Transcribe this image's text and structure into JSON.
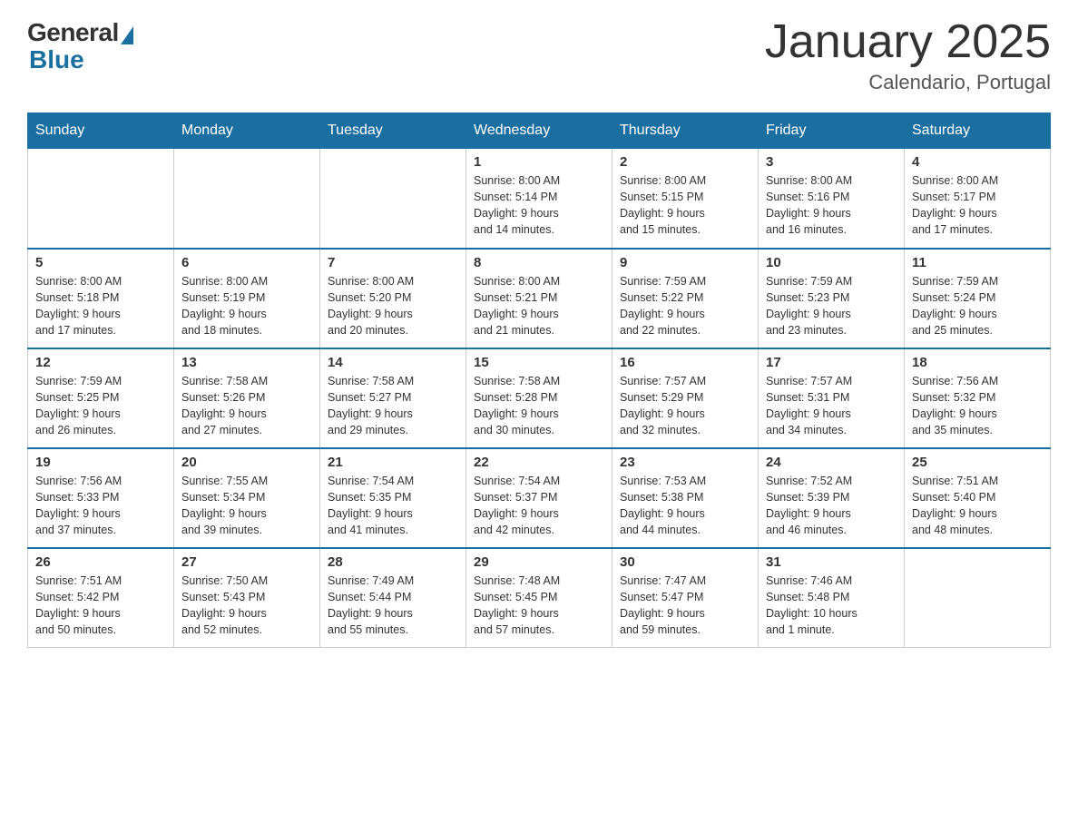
{
  "logo": {
    "general": "General",
    "blue": "Blue"
  },
  "title": "January 2025",
  "subtitle": "Calendario, Portugal",
  "days": [
    "Sunday",
    "Monday",
    "Tuesday",
    "Wednesday",
    "Thursday",
    "Friday",
    "Saturday"
  ],
  "weeks": [
    [
      {
        "num": "",
        "info": ""
      },
      {
        "num": "",
        "info": ""
      },
      {
        "num": "",
        "info": ""
      },
      {
        "num": "1",
        "info": "Sunrise: 8:00 AM\nSunset: 5:14 PM\nDaylight: 9 hours\nand 14 minutes."
      },
      {
        "num": "2",
        "info": "Sunrise: 8:00 AM\nSunset: 5:15 PM\nDaylight: 9 hours\nand 15 minutes."
      },
      {
        "num": "3",
        "info": "Sunrise: 8:00 AM\nSunset: 5:16 PM\nDaylight: 9 hours\nand 16 minutes."
      },
      {
        "num": "4",
        "info": "Sunrise: 8:00 AM\nSunset: 5:17 PM\nDaylight: 9 hours\nand 17 minutes."
      }
    ],
    [
      {
        "num": "5",
        "info": "Sunrise: 8:00 AM\nSunset: 5:18 PM\nDaylight: 9 hours\nand 17 minutes."
      },
      {
        "num": "6",
        "info": "Sunrise: 8:00 AM\nSunset: 5:19 PM\nDaylight: 9 hours\nand 18 minutes."
      },
      {
        "num": "7",
        "info": "Sunrise: 8:00 AM\nSunset: 5:20 PM\nDaylight: 9 hours\nand 20 minutes."
      },
      {
        "num": "8",
        "info": "Sunrise: 8:00 AM\nSunset: 5:21 PM\nDaylight: 9 hours\nand 21 minutes."
      },
      {
        "num": "9",
        "info": "Sunrise: 7:59 AM\nSunset: 5:22 PM\nDaylight: 9 hours\nand 22 minutes."
      },
      {
        "num": "10",
        "info": "Sunrise: 7:59 AM\nSunset: 5:23 PM\nDaylight: 9 hours\nand 23 minutes."
      },
      {
        "num": "11",
        "info": "Sunrise: 7:59 AM\nSunset: 5:24 PM\nDaylight: 9 hours\nand 25 minutes."
      }
    ],
    [
      {
        "num": "12",
        "info": "Sunrise: 7:59 AM\nSunset: 5:25 PM\nDaylight: 9 hours\nand 26 minutes."
      },
      {
        "num": "13",
        "info": "Sunrise: 7:58 AM\nSunset: 5:26 PM\nDaylight: 9 hours\nand 27 minutes."
      },
      {
        "num": "14",
        "info": "Sunrise: 7:58 AM\nSunset: 5:27 PM\nDaylight: 9 hours\nand 29 minutes."
      },
      {
        "num": "15",
        "info": "Sunrise: 7:58 AM\nSunset: 5:28 PM\nDaylight: 9 hours\nand 30 minutes."
      },
      {
        "num": "16",
        "info": "Sunrise: 7:57 AM\nSunset: 5:29 PM\nDaylight: 9 hours\nand 32 minutes."
      },
      {
        "num": "17",
        "info": "Sunrise: 7:57 AM\nSunset: 5:31 PM\nDaylight: 9 hours\nand 34 minutes."
      },
      {
        "num": "18",
        "info": "Sunrise: 7:56 AM\nSunset: 5:32 PM\nDaylight: 9 hours\nand 35 minutes."
      }
    ],
    [
      {
        "num": "19",
        "info": "Sunrise: 7:56 AM\nSunset: 5:33 PM\nDaylight: 9 hours\nand 37 minutes."
      },
      {
        "num": "20",
        "info": "Sunrise: 7:55 AM\nSunset: 5:34 PM\nDaylight: 9 hours\nand 39 minutes."
      },
      {
        "num": "21",
        "info": "Sunrise: 7:54 AM\nSunset: 5:35 PM\nDaylight: 9 hours\nand 41 minutes."
      },
      {
        "num": "22",
        "info": "Sunrise: 7:54 AM\nSunset: 5:37 PM\nDaylight: 9 hours\nand 42 minutes."
      },
      {
        "num": "23",
        "info": "Sunrise: 7:53 AM\nSunset: 5:38 PM\nDaylight: 9 hours\nand 44 minutes."
      },
      {
        "num": "24",
        "info": "Sunrise: 7:52 AM\nSunset: 5:39 PM\nDaylight: 9 hours\nand 46 minutes."
      },
      {
        "num": "25",
        "info": "Sunrise: 7:51 AM\nSunset: 5:40 PM\nDaylight: 9 hours\nand 48 minutes."
      }
    ],
    [
      {
        "num": "26",
        "info": "Sunrise: 7:51 AM\nSunset: 5:42 PM\nDaylight: 9 hours\nand 50 minutes."
      },
      {
        "num": "27",
        "info": "Sunrise: 7:50 AM\nSunset: 5:43 PM\nDaylight: 9 hours\nand 52 minutes."
      },
      {
        "num": "28",
        "info": "Sunrise: 7:49 AM\nSunset: 5:44 PM\nDaylight: 9 hours\nand 55 minutes."
      },
      {
        "num": "29",
        "info": "Sunrise: 7:48 AM\nSunset: 5:45 PM\nDaylight: 9 hours\nand 57 minutes."
      },
      {
        "num": "30",
        "info": "Sunrise: 7:47 AM\nSunset: 5:47 PM\nDaylight: 9 hours\nand 59 minutes."
      },
      {
        "num": "31",
        "info": "Sunrise: 7:46 AM\nSunset: 5:48 PM\nDaylight: 10 hours\nand 1 minute."
      },
      {
        "num": "",
        "info": ""
      }
    ]
  ]
}
